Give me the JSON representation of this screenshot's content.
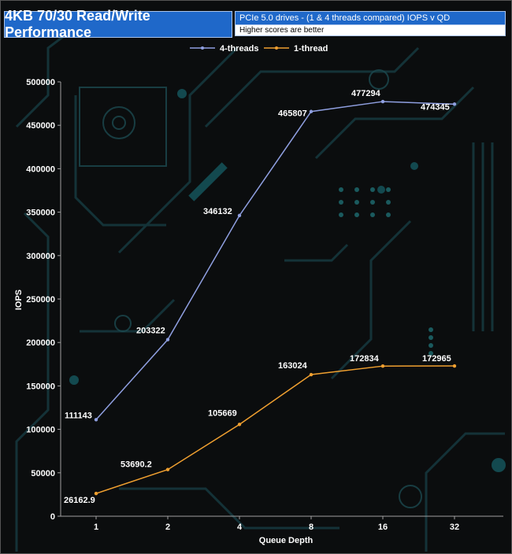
{
  "header": {
    "title": "4KB 70/30 Read/Write Performance",
    "subtitle": "PCIe 5.0 drives - (1 & 4 threads compared) IOPS v QD",
    "note": "Higher scores are better"
  },
  "chart_data": {
    "type": "line",
    "categories": [
      "1",
      "2",
      "4",
      "8",
      "16",
      "32"
    ],
    "xlabel": "Queue Depth",
    "ylabel": "IOPS",
    "ylim": [
      0,
      500000
    ],
    "yticks": [
      0,
      50000,
      100000,
      150000,
      200000,
      250000,
      300000,
      350000,
      400000,
      450000,
      500000
    ],
    "legend_position": "top",
    "grid": false,
    "series": [
      {
        "name": "4-threads",
        "color": "#8f9fe0",
        "values": [
          111143,
          203322,
          346132,
          465807,
          477294,
          474345
        ],
        "labels": [
          "111143",
          "203322",
          "346132",
          "465807",
          "477294",
          "474345"
        ]
      },
      {
        "name": "1-thread",
        "color": "#f0a030",
        "values": [
          26162.9,
          53690.2,
          105669,
          163024,
          172834,
          172965
        ],
        "labels": [
          "26162.9",
          "53690.2",
          "105669",
          "163024",
          "172834",
          "172965"
        ]
      }
    ]
  }
}
